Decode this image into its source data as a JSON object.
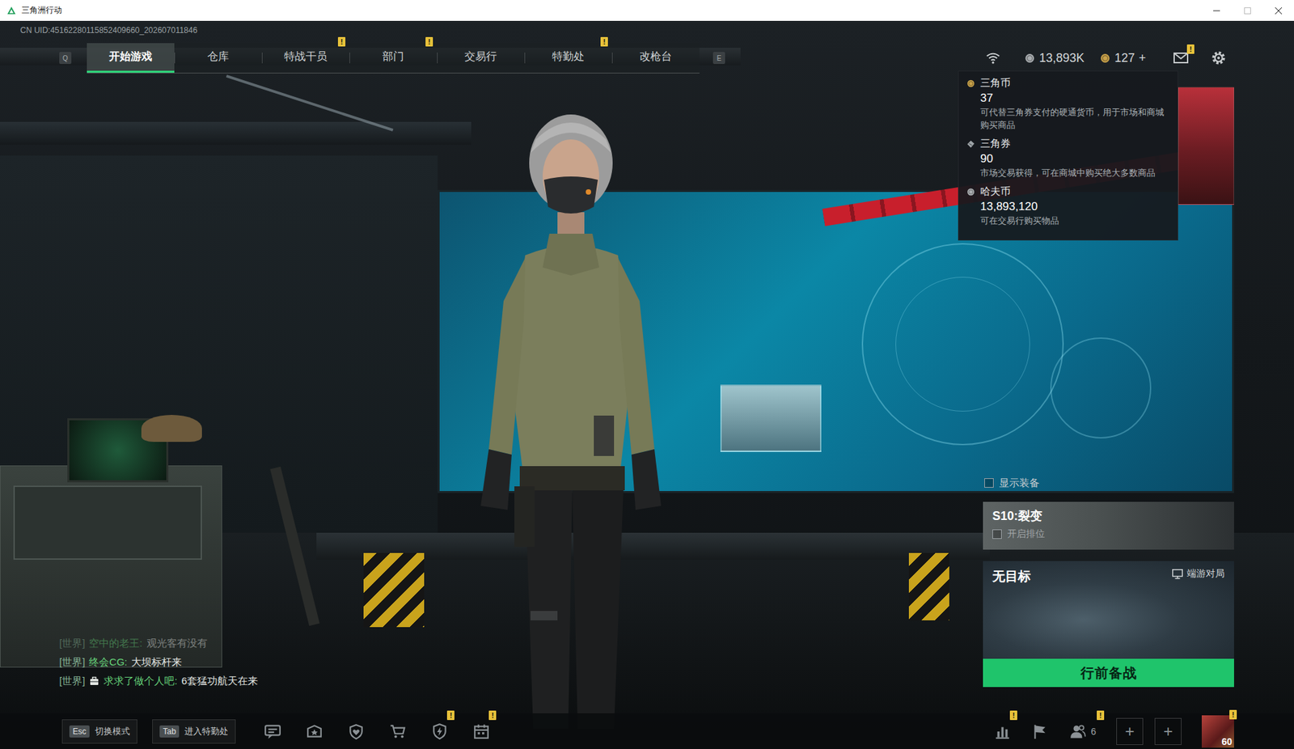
{
  "window": {
    "title": "三角洲行动"
  },
  "uid": "CN UID:45162280115852409660_202607011846",
  "nav": {
    "prev_key": "Q",
    "next_key": "E",
    "tabs": [
      {
        "label": "开始游戏",
        "selected": true,
        "badge": null
      },
      {
        "label": "仓库",
        "selected": false,
        "badge": null
      },
      {
        "label": "特战干员",
        "selected": false,
        "badge": "!"
      },
      {
        "label": "部门",
        "selected": false,
        "badge": "!"
      },
      {
        "label": "交易行",
        "selected": false,
        "badge": null
      },
      {
        "label": "特勤处",
        "selected": false,
        "badge": "!"
      },
      {
        "label": "改枪台",
        "selected": false,
        "badge": null
      }
    ]
  },
  "wallet": [
    {
      "amount": "13,893K",
      "add": null,
      "color": "#a9adb0"
    },
    {
      "amount": "127",
      "add": "+",
      "color": "#c9a24a"
    }
  ],
  "mail": {
    "badge": "!"
  },
  "currency_tooltip": [
    {
      "name": "三角币",
      "amount": "37",
      "description": "可代替三角券支付的硬通货币，用于市场和商城购买商品",
      "kind": "coin",
      "color": "#c9a24a"
    },
    {
      "name": "三角券",
      "amount": "90",
      "description": "市场交易获得，可在商城中购买绝大多数商品",
      "kind": "ticket",
      "color": "#9ea4a8"
    },
    {
      "name": "哈夫币",
      "amount": "13,893,120",
      "description": "可在交易行购买物品",
      "kind": "coin",
      "color": "#a9adb0"
    }
  ],
  "show_gear": {
    "label": "显示装备",
    "checked": false
  },
  "season": {
    "title": "S10:裂变",
    "ranked": {
      "label": "开启排位",
      "checked": false
    }
  },
  "mode": {
    "title": "无目标",
    "platform": "端游对局"
  },
  "start_button": {
    "label": "行前备战"
  },
  "chat": [
    {
      "channel": "[世界]",
      "sender": "空中的老王:",
      "message": "观光客有没有",
      "faded": true,
      "kind": "plain"
    },
    {
      "channel": "[世界]",
      "sender": "终会CG:",
      "message": "大坝标杆来",
      "faded": false,
      "kind": "plain"
    },
    {
      "channel": "[世界]",
      "sender": "求求了做个人吧:",
      "message": "6套猛功航天在来",
      "faded": false,
      "kind": "with-icon"
    }
  ],
  "bottom_bar": {
    "shortcuts": [
      {
        "key": "Esc",
        "label": "切换模式"
      },
      {
        "key": "Tab",
        "label": "进入特勤处"
      }
    ],
    "tools": [
      {
        "badge": null
      },
      {
        "badge": null
      },
      {
        "badge": null
      },
      {
        "badge": null
      },
      {
        "badge": "!"
      },
      {
        "badge": "!"
      }
    ],
    "right_tools": [
      {
        "badge": "!"
      },
      {
        "badge": null
      }
    ],
    "team": {
      "count": "6",
      "badge": "!"
    },
    "slots": [
      "+",
      "+"
    ],
    "profile": {
      "level": "60",
      "badge": "!"
    }
  }
}
